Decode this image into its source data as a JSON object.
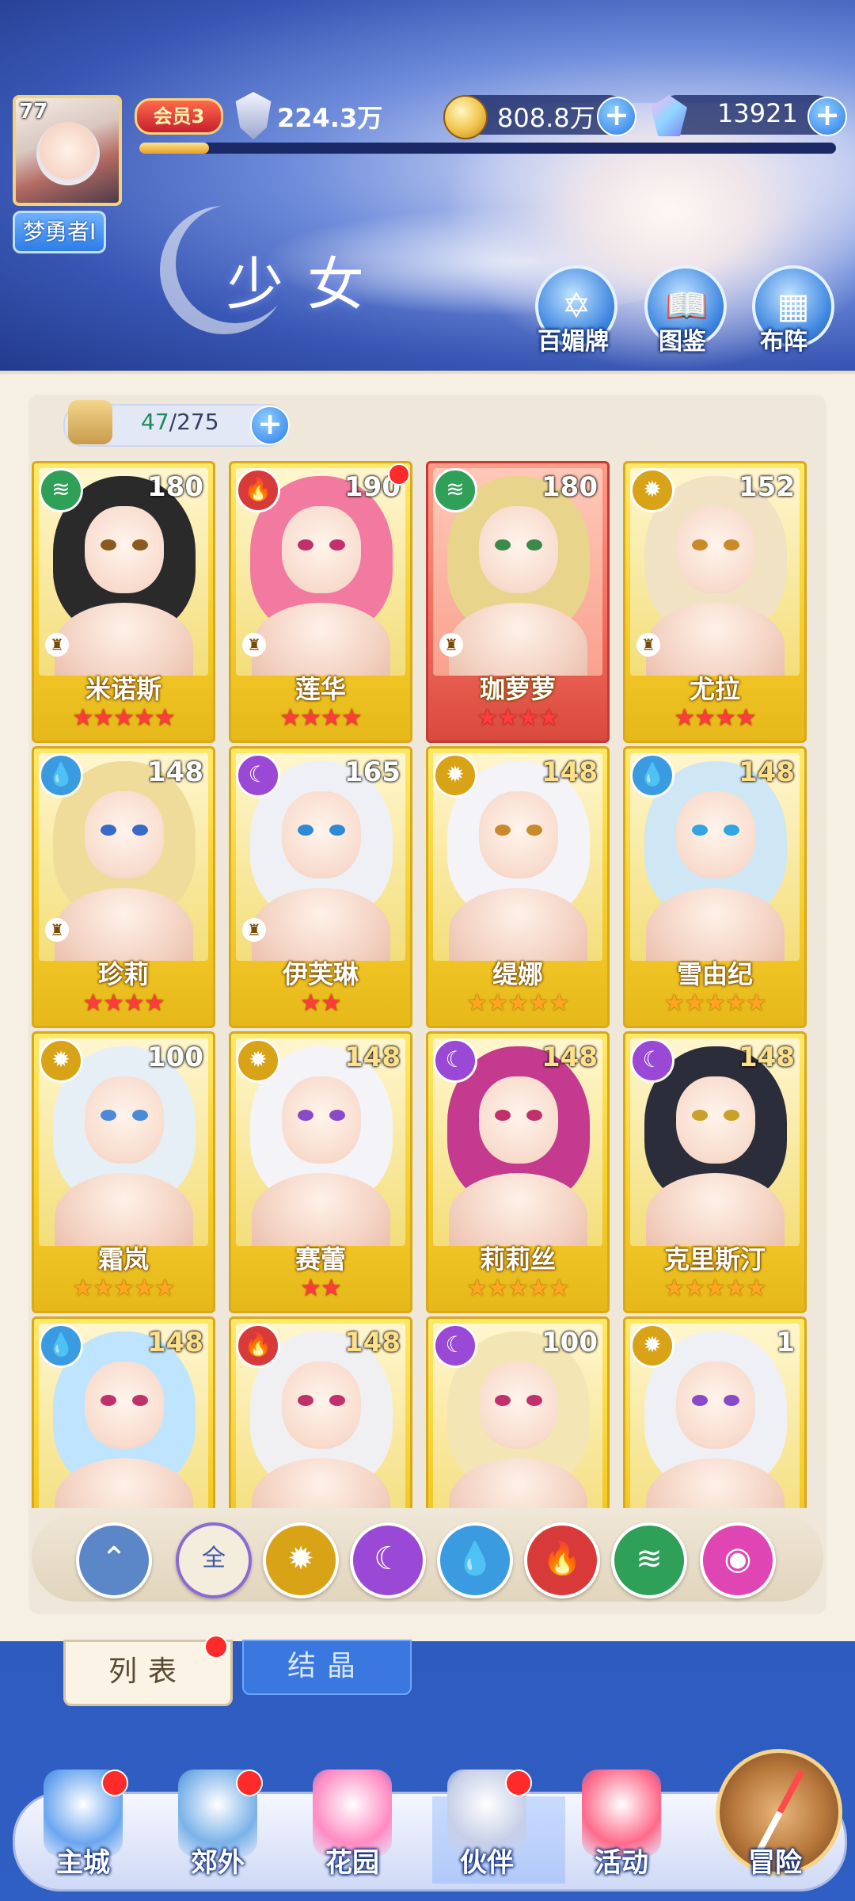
{
  "header": {
    "title": "少女",
    "level": "77",
    "player_name": "梦勇者I",
    "vip_label": "会员3",
    "power": "224.3万",
    "xp_fraction": 0.1,
    "gold": "808.8万",
    "gems": "13921",
    "features": [
      {
        "label": "百媚牌",
        "icon": "seal-icon"
      },
      {
        "label": "图鉴",
        "icon": "book-icon"
      },
      {
        "label": "布阵",
        "icon": "grid-icon"
      }
    ]
  },
  "roster": {
    "count_current": "47",
    "count_total": "/275"
  },
  "cards": [
    {
      "name": "米诺斯",
      "level": "180",
      "element": "wind",
      "stars": 5,
      "star_color": "red",
      "frame": "gold",
      "rook": true,
      "dot": false,
      "level_color": "white"
    },
    {
      "name": "莲华",
      "level": "190",
      "element": "fire",
      "stars": 4,
      "star_color": "red",
      "frame": "gold",
      "rook": true,
      "dot": true,
      "level_color": "white"
    },
    {
      "name": "珈萝萝",
      "level": "180",
      "element": "wind",
      "stars": 4,
      "star_color": "red",
      "frame": "red",
      "rook": true,
      "dot": false,
      "level_color": "white"
    },
    {
      "name": "尤拉",
      "level": "152",
      "element": "light",
      "stars": 4,
      "star_color": "red",
      "frame": "gold",
      "rook": true,
      "dot": false,
      "level_color": "white"
    },
    {
      "name": "珍莉",
      "level": "148",
      "element": "water",
      "stars": 4,
      "star_color": "red",
      "frame": "gold",
      "rook": true,
      "dot": false,
      "level_color": "white"
    },
    {
      "name": "伊芙琳",
      "level": "165",
      "element": "dark",
      "stars": 2,
      "star_color": "red",
      "frame": "gold",
      "rook": true,
      "dot": false,
      "level_color": "white"
    },
    {
      "name": "缇娜",
      "level": "148",
      "element": "light",
      "stars": 5,
      "star_color": "gold",
      "frame": "gold",
      "rook": false,
      "dot": false,
      "level_color": "gold"
    },
    {
      "name": "雪由纪",
      "level": "148",
      "element": "water",
      "stars": 5,
      "star_color": "gold",
      "frame": "gold",
      "rook": false,
      "dot": false,
      "level_color": "gold"
    },
    {
      "name": "霜岚",
      "level": "100",
      "element": "light",
      "stars": 5,
      "star_color": "gold",
      "frame": "gold",
      "rook": false,
      "dot": false,
      "level_color": "white"
    },
    {
      "name": "赛蕾",
      "level": "148",
      "element": "light",
      "stars": 2,
      "star_color": "red",
      "frame": "gold",
      "rook": false,
      "dot": false,
      "level_color": "gold"
    },
    {
      "name": "莉莉丝",
      "level": "148",
      "element": "dark",
      "stars": 5,
      "star_color": "gold",
      "frame": "gold",
      "rook": false,
      "dot": false,
      "level_color": "gold"
    },
    {
      "name": "克里斯汀",
      "level": "148",
      "element": "dark",
      "stars": 5,
      "star_color": "gold",
      "frame": "gold",
      "rook": false,
      "dot": false,
      "level_color": "gold"
    },
    {
      "name": "",
      "level": "148",
      "element": "water",
      "stars": 0,
      "star_color": "gold",
      "frame": "gold",
      "rook": false,
      "dot": false,
      "level_color": "gold"
    },
    {
      "name": "",
      "level": "148",
      "element": "fire",
      "stars": 0,
      "star_color": "gold",
      "frame": "gold",
      "rook": false,
      "dot": false,
      "level_color": "gold"
    },
    {
      "name": "",
      "level": "100",
      "element": "dark",
      "stars": 0,
      "star_color": "gold",
      "frame": "gold",
      "rook": false,
      "dot": false,
      "level_color": "white"
    },
    {
      "name": "",
      "level": "1",
      "element": "light",
      "stars": 0,
      "star_color": "gold",
      "frame": "gold",
      "rook": false,
      "dot": false,
      "level_color": "white"
    }
  ],
  "filters": [
    {
      "key": "collapse",
      "label": "⌃",
      "icon": "collapse-icon",
      "color": "#5b86c8"
    },
    {
      "key": "all",
      "label": "全",
      "icon": "all-filter",
      "color": "#f4ecdc"
    },
    {
      "key": "light",
      "label": "✹",
      "icon": "light-element-icon",
      "color": "#d9a318"
    },
    {
      "key": "dark",
      "label": "☾",
      "icon": "dark-element-icon",
      "color": "#9a48d6"
    },
    {
      "key": "water",
      "label": "💧",
      "icon": "water-element-icon",
      "color": "#3a9be0"
    },
    {
      "key": "fire",
      "label": "🔥",
      "icon": "fire-element-icon",
      "color": "#d83a3a"
    },
    {
      "key": "wind",
      "label": "≋",
      "icon": "wind-element-icon",
      "color": "#2ea058"
    },
    {
      "key": "heart",
      "label": "◉",
      "icon": "heart-element-icon",
      "color": "#e045b4"
    }
  ],
  "tabs": {
    "list": "列表",
    "crystal": "结晶"
  },
  "nav": [
    {
      "label": "主城",
      "icon": "castle-icon",
      "dot": true,
      "color": "#6aa6ef"
    },
    {
      "label": "郊外",
      "icon": "portal-icon",
      "dot": true,
      "color": "#7ab2e8"
    },
    {
      "label": "花园",
      "icon": "heart-icon",
      "dot": false,
      "color": "#ff8ac2"
    },
    {
      "label": "伙伴",
      "icon": "partner-icon",
      "dot": true,
      "color": "#c7cfe8"
    },
    {
      "label": "活动",
      "icon": "gift-icon",
      "dot": false,
      "color": "#ff6a8a"
    },
    {
      "label": "冒险",
      "icon": "compass-icon",
      "dot": false,
      "color": "#c78a4a"
    }
  ],
  "colors": {
    "wind": "#2ea058",
    "fire": "#d83a3a",
    "light": "#d9a318",
    "water": "#3a9be0",
    "dark": "#9a48d6"
  }
}
